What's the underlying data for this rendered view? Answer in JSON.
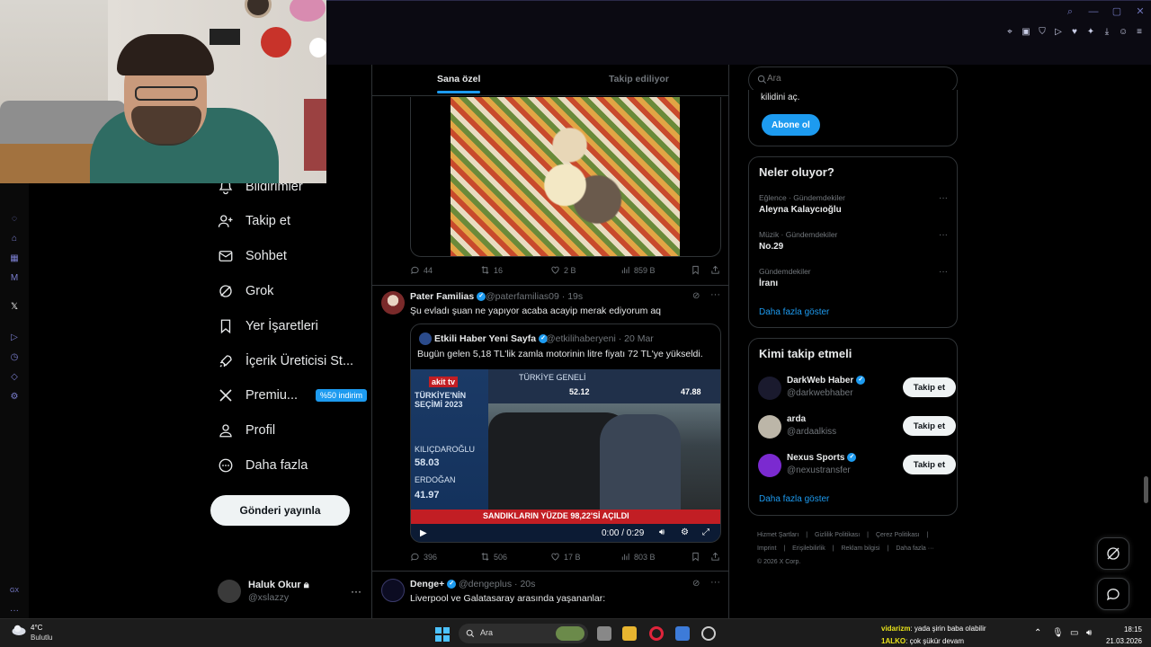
{
  "timeline": {
    "tabs": [
      "Sana özel",
      "Takip ediliyor"
    ],
    "tweet1_stats": {
      "replies": "44",
      "retweets": "16",
      "likes": "2 B",
      "views": "859 B"
    },
    "tweet2": {
      "name": "Pater Familias",
      "handle": "@paterfamilias09",
      "time": "· 19s",
      "text": "Şu evladı şuan ne yapıyor acaba acayip merak ediyorum aq",
      "quote": {
        "name": "Etkili Haber Yeni Sayfa",
        "handle": "@etkilihaberyeni",
        "time": "· 20 Mar",
        "text": "Bugün gelen 5,18 TL'lik zamla motorinin litre fiyatı 72 TL'ye yükseldi."
      },
      "video": {
        "channel": "akit tv",
        "headline": "TÜRKİYE'NİN SEÇİMİ 2023",
        "ticker": "SANDIKLARIN YÜZDE 98,22'Sİ AÇILDI",
        "top_label": "TÜRKİYE GENELİ",
        "score_left": "52.12",
        "score_right": "47.88",
        "candidates": [
          {
            "name": "KILIÇDAROĞLU",
            "value": "58.03"
          },
          {
            "name": "ERDOĞAN",
            "value": "41.97"
          }
        ],
        "time": "0:00 / 0:29"
      },
      "stats": {
        "replies": "396",
        "retweets": "506",
        "likes": "17 B",
        "views": "803 B"
      }
    },
    "tweet3": {
      "name": "Denge+",
      "handle": "@dengeplus",
      "time": "· 20s",
      "text": "Liverpool ve Galatasaray arasında yaşananlar:"
    }
  },
  "nav": {
    "items": [
      {
        "label": "Bildirimler",
        "icon": "bell-icon"
      },
      {
        "label": "Takip et",
        "icon": "person-plus-icon"
      },
      {
        "label": "Sohbet",
        "icon": "mail-icon"
      },
      {
        "label": "Grok",
        "icon": "grok-icon"
      },
      {
        "label": "Yer İşaretleri",
        "icon": "bookmark-icon"
      },
      {
        "label": "İçerik Üreticisi St...",
        "icon": "rocket-icon"
      },
      {
        "label": "Premiu...",
        "icon": "x-logo-icon",
        "badge": "%50 indirim"
      },
      {
        "label": "Profil",
        "icon": "person-icon"
      },
      {
        "label": "Daha fazla",
        "icon": "more-circle-icon"
      }
    ],
    "post_button": "Gönderi yayınla",
    "account": {
      "name": "Haluk Okur",
      "handle": "@xslazzy",
      "more": "···"
    }
  },
  "sidebar": {
    "search_placeholder": "Ara",
    "premium": {
      "text": "kilidini aç.",
      "button": "Abone ol"
    },
    "trends": {
      "title": "Neler oluyor?",
      "items": [
        {
          "category": "Eğlence · Gündemdekiler",
          "name": "Aleyna Kalaycıoğlu"
        },
        {
          "category": "Müzik · Gündemdekiler",
          "name": "No.29"
        },
        {
          "category": "Gündemdekiler",
          "name": "İranı"
        }
      ],
      "show_more": "Daha fazla göster"
    },
    "who_to_follow": {
      "title": "Kimi takip etmeli",
      "items": [
        {
          "name": "DarkWeb Haber",
          "handle": "@darkwebhaber",
          "button": "Takip et",
          "verified": true,
          "avatar_color": "#1a1a2e"
        },
        {
          "name": "arda",
          "handle": "@ardaalkiss",
          "button": "Takip et",
          "verified": false,
          "avatar_color": "#bcb6a8"
        },
        {
          "name": "Nexus Sports",
          "handle": "@nexustransfer",
          "button": "Takip et",
          "verified": true,
          "avatar_color": "#7b2ad0"
        }
      ],
      "show_more": "Daha fazla göster"
    },
    "footer": {
      "links": [
        "Hizmet Şartları",
        "|",
        "Gizlilik Politikası",
        "|",
        "Çerez Politikası",
        "|",
        "Imprint",
        "|",
        "Erişilebilirlik",
        "|",
        "Reklam bilgisi",
        "|",
        "Daha fazla ···"
      ],
      "copyright": "© 2026 X Corp."
    }
  },
  "taskbar": {
    "weather_temp": "4°C",
    "weather_desc": "Bulutlu",
    "search_label": "Ara",
    "chat": [
      {
        "user": "vidarizm",
        "text": ": yada şirin baba olabilir"
      },
      {
        "user": "1ALKO",
        "text": ": çok şükür devam"
      }
    ],
    "time": "18:15",
    "date": "21.03.2026"
  },
  "colors": {
    "accent": "#1d9bf0",
    "background": "#000000",
    "border": "#2f3336",
    "muted": "#71767b"
  }
}
